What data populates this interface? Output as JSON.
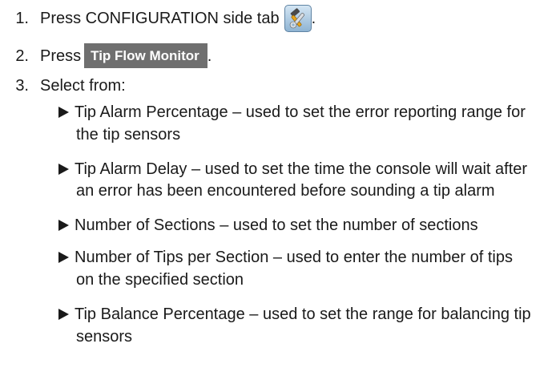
{
  "steps": [
    {
      "number": "1.",
      "text_before": "Press CONFIGURATION side tab",
      "icon": "configuration-tools-icon",
      "text_after": "."
    },
    {
      "number": "2.",
      "text_before": "Press",
      "button_label": "Tip Flow Monitor",
      "text_after": "."
    },
    {
      "number": "3.",
      "text": "Select from:"
    }
  ],
  "options": [
    {
      "lines": [
        "Tip Alarm Percentage – used to set the error reporting range for",
        "the tip sensors"
      ]
    },
    {
      "lines": [
        "Tip Alarm Delay – used to set the time the console will wait after",
        "an error has been encountered before sounding a tip alarm"
      ]
    },
    {
      "lines": [
        "Number of Sections – used to set the number of sections"
      ]
    },
    {
      "lines": [
        "Number of Tips per Section – used to enter the number of tips",
        "on the specified section"
      ]
    },
    {
      "lines": [
        "Tip Balance Percentage – used to set the range for balancing tip",
        "sensors"
      ]
    }
  ],
  "colors": {
    "text": "#1a1a1a",
    "button_background": "#6f6f6f",
    "button_text": "#ffffff",
    "icon_background": "#8fb4d3"
  }
}
